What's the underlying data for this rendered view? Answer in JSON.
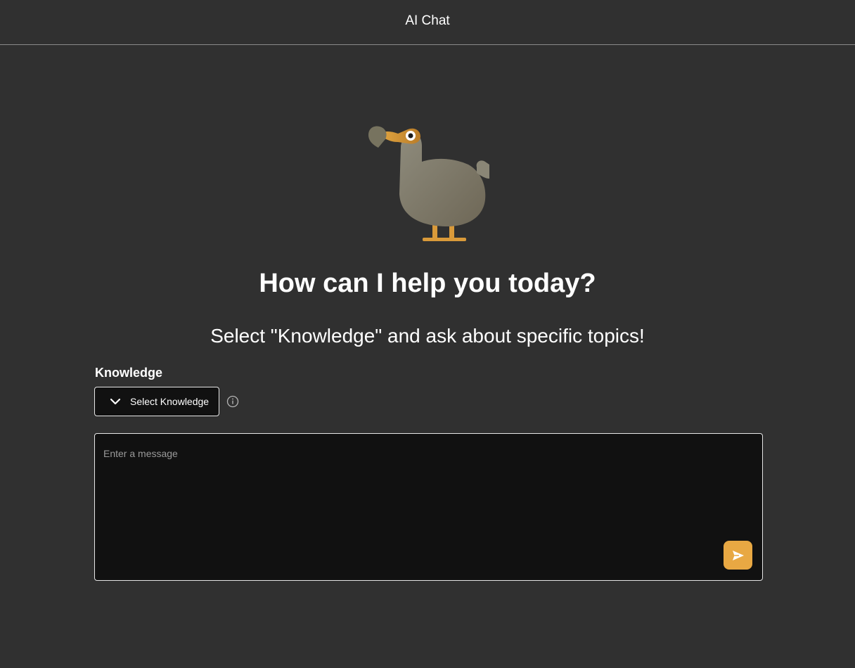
{
  "header": {
    "title": "AI Chat"
  },
  "main": {
    "headline": "How can I help you today?",
    "subline": "Select \"Knowledge\" and ask about specific topics!"
  },
  "knowledge": {
    "label": "Knowledge",
    "select_label": "Select Knowledge",
    "chevron_icon": "chevron-down-icon",
    "info_icon": "info-icon"
  },
  "composer": {
    "placeholder": "Enter a message",
    "value": "",
    "send_icon": "send-icon"
  },
  "mascot": {
    "icon": "dodo-mascot"
  },
  "colors": {
    "background": "#303030",
    "panel": "#111111",
    "accent": "#e8a843",
    "border": "#e6e6e6",
    "bird_body": "#8a8676",
    "bird_beak": "#d99a3a"
  }
}
